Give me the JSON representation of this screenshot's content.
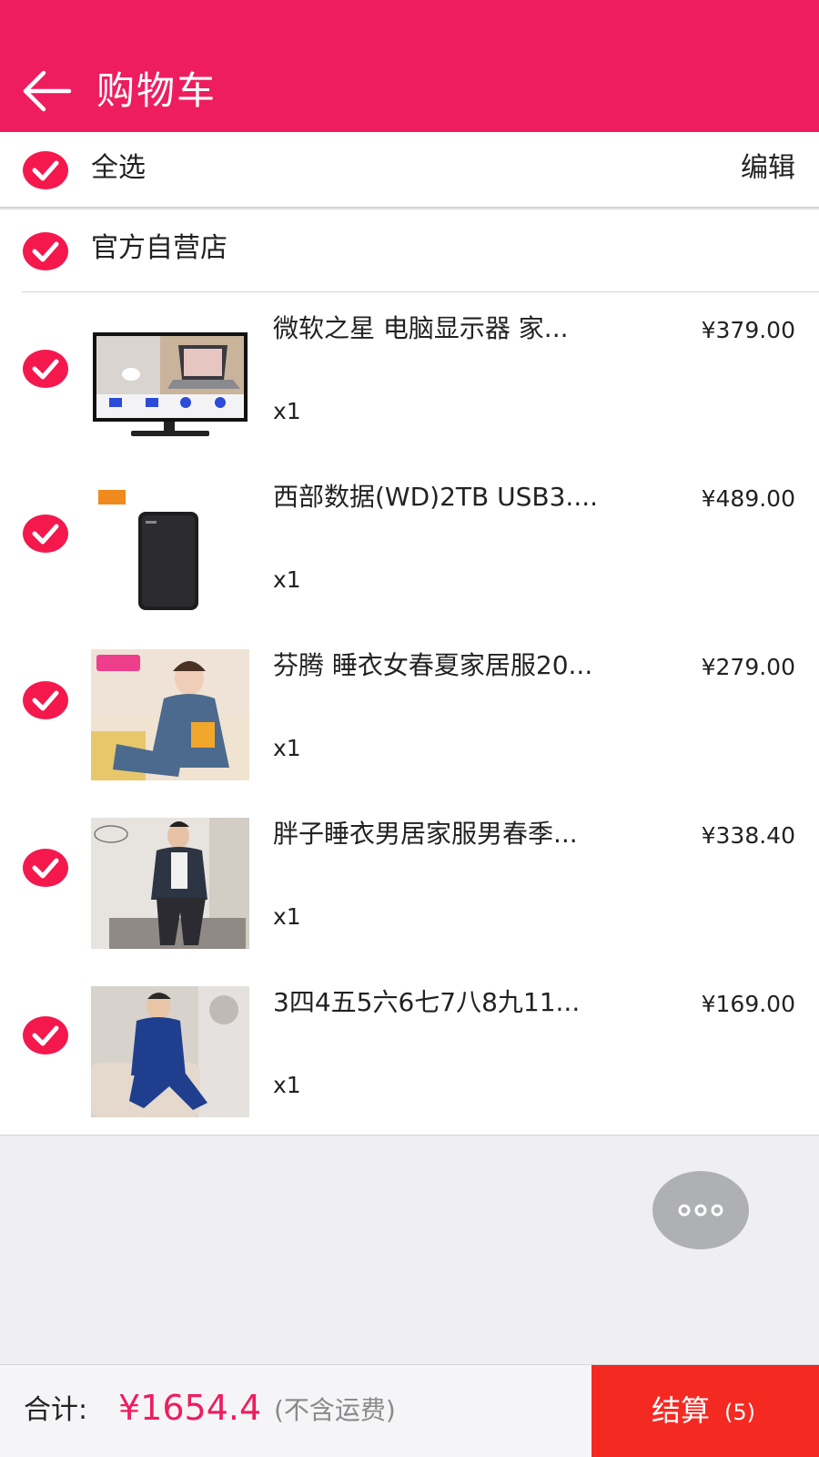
{
  "header": {
    "title": "购物车",
    "back_icon": "arrow-left-icon"
  },
  "select_all": {
    "label": "全选",
    "edit_label": "编辑",
    "checked": true
  },
  "store": {
    "name": "官方自营店",
    "checked": true
  },
  "items": [
    {
      "name": "微软之星 电脑显示器 家...",
      "price": "¥379.00",
      "qty": "x1",
      "checked": true
    },
    {
      "name": "西部数据(WD)2TB USB3....",
      "price": "¥489.00",
      "qty": "x1",
      "checked": true
    },
    {
      "name": "芬腾 睡衣女春夏家居服20...",
      "price": "¥279.00",
      "qty": "x1",
      "checked": true
    },
    {
      "name": "胖子睡衣男居家服男春季...",
      "price": "¥338.40",
      "qty": "x1",
      "checked": true
    },
    {
      "name": "3四4五5六6七7八8九11...",
      "price": "¥169.00",
      "qty": "x1",
      "checked": true
    }
  ],
  "footer": {
    "total_label": "合计:",
    "total_amount": "¥1654.4",
    "total_note": "(不含运费)",
    "checkout_label": "结算",
    "checkout_count": "(5)"
  },
  "colors": {
    "brand": "#ee1d5f",
    "checkout": "#f42a22",
    "check": "#f4184d"
  }
}
